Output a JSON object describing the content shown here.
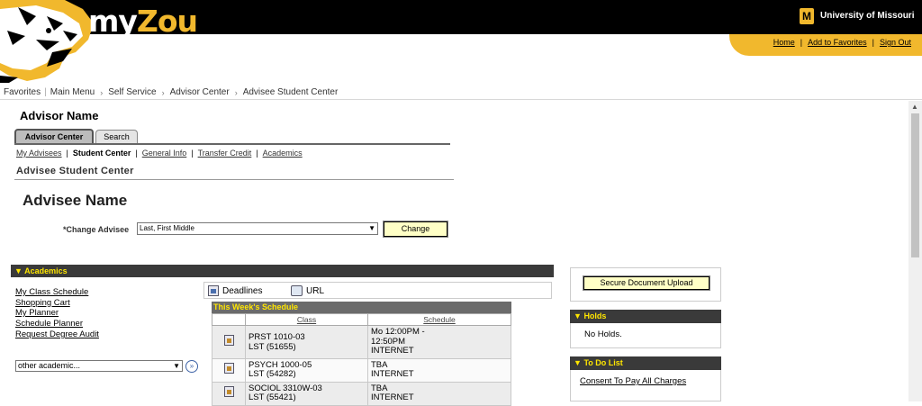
{
  "header": {
    "brand_prefix": "my",
    "brand_suffix": "Zou",
    "university_mark": "M",
    "university": "University of Missouri",
    "links": [
      {
        "label": "Home"
      },
      {
        "label": "Add to Favorites"
      },
      {
        "label": "Sign Out"
      }
    ]
  },
  "breadcrumb": {
    "favorites": "Favorites",
    "main_menu": "Main Menu",
    "self_service": "Self Service",
    "advisor_center": "Advisor Center",
    "advisee_student_center": "Advisee Student Center"
  },
  "advisor": {
    "name": "Advisor Name",
    "tabs": {
      "active": "Advisor Center",
      "inactive": "Search"
    },
    "subnav": {
      "my_advisees": "My Advisees",
      "student_center": "Student Center",
      "general_info": "General Info",
      "transfer_credit": "Transfer Credit",
      "academics": "Academics"
    },
    "section_title": "Advisee Student Center"
  },
  "advisee": {
    "name": "Advisee Name",
    "change_label": "*Change Advisee",
    "select_value": "Last, First Middle",
    "change_button": "Change"
  },
  "academics": {
    "header": "Academics",
    "links": {
      "class_schedule": "My Class Schedule",
      "shopping_cart": "Shopping Cart",
      "planner": "My Planner",
      "schedule_planner": "Schedule Planner",
      "degree_audit": "Request Degree Audit"
    },
    "other_select": "other academic...",
    "deadlines": "Deadlines",
    "url": "URL",
    "schedule": {
      "title": "This Week's Schedule",
      "headers": {
        "class": "Class",
        "schedule": "Schedule"
      },
      "rows": [
        {
          "class_line1": "PRST 1010-03",
          "class_line2": "LST (51655)",
          "sched_line1": "Mo 12:00PM -",
          "sched_line2": "12:50PM",
          "sched_line3": "INTERNET"
        },
        {
          "class_line1": "PSYCH 1000-05",
          "class_line2": "LST (54282)",
          "sched_line1": "TBA",
          "sched_line2": "INTERNET",
          "sched_line3": ""
        },
        {
          "class_line1": "SOCIOL 3310W-03",
          "class_line2": "LST (55421)",
          "sched_line1": "TBA",
          "sched_line2": "INTERNET",
          "sched_line3": ""
        }
      ]
    }
  },
  "right": {
    "upload_button": "Secure Document Upload",
    "holds_header": "Holds",
    "holds_text": "No Holds.",
    "todo_header": "To Do List",
    "todo_item": "Consent To Pay All Charges"
  },
  "colors": {
    "gold": "#f1b82d",
    "black": "#000000",
    "section_header": "#3a3a3a",
    "button_fill": "#ffffc6"
  }
}
